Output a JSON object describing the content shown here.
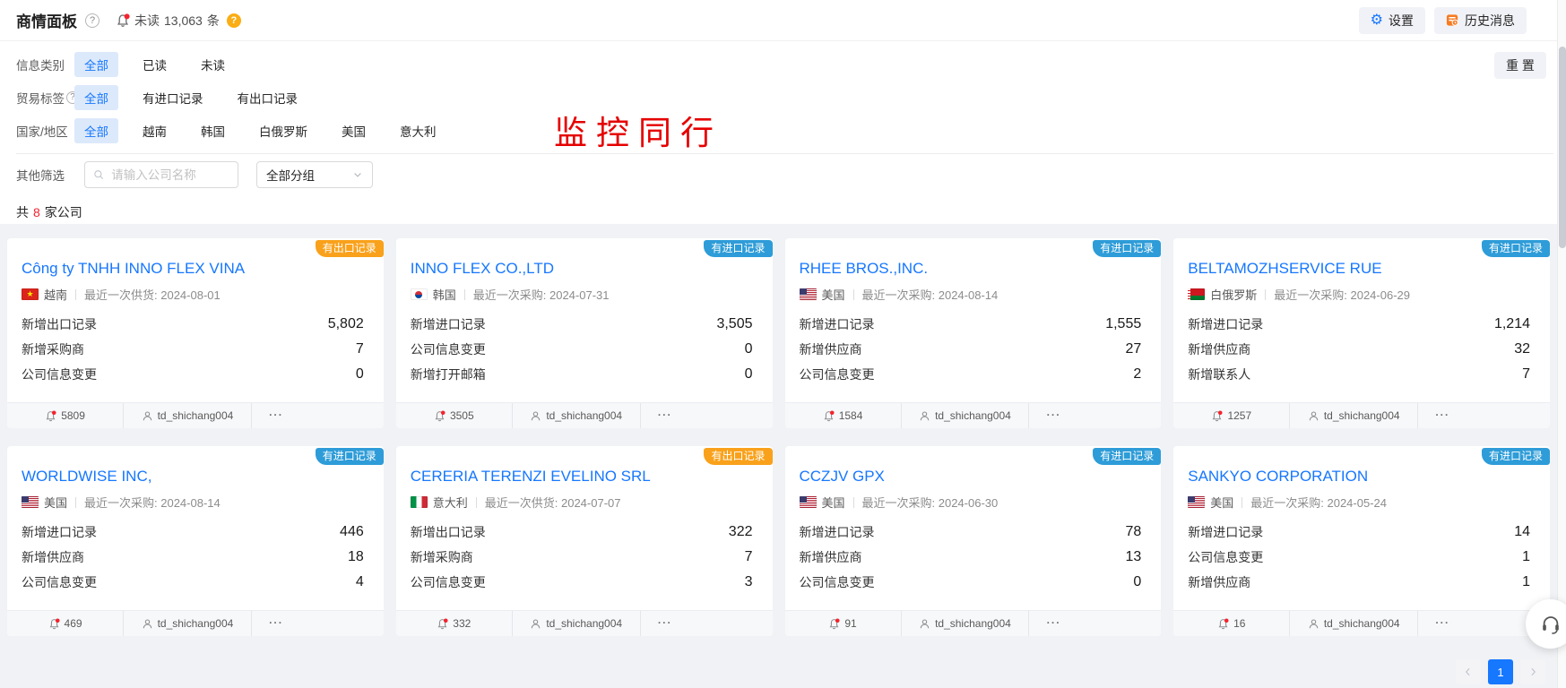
{
  "header": {
    "title": "商情面板",
    "unread_label": "未读",
    "unread_count": "13,063",
    "unread_unit": "条",
    "settings_button": "设置",
    "history_button": "历史消息"
  },
  "filters": {
    "reset_button": "重 置",
    "rows": [
      {
        "label": "信息类别",
        "has_help": false,
        "selected": 0,
        "options": [
          "全部",
          "已读",
          "未读"
        ]
      },
      {
        "label": "贸易标签",
        "has_help": true,
        "selected": 0,
        "options": [
          "全部",
          "有进口记录",
          "有出口记录"
        ]
      },
      {
        "label": "国家/地区",
        "has_help": false,
        "selected": 0,
        "options": [
          "全部",
          "越南",
          "韩国",
          "白俄罗斯",
          "美国",
          "意大利"
        ]
      }
    ],
    "other_label": "其他筛选",
    "search_placeholder": "请输入公司名称",
    "group_select_value": "全部分组"
  },
  "annotation": "监控同行",
  "summary": {
    "prefix": "共",
    "count": "8",
    "suffix": "家公司"
  },
  "labels": {
    "more": "..."
  },
  "cards": [
    {
      "badge": "有出口记录",
      "badge_type": "export",
      "name": "Công ty TNHH INNO FLEX VINA",
      "flag": "vn",
      "country": "越南",
      "last_trade": "最近一次供货: 2024-08-01",
      "metrics": [
        {
          "label": "新增出口记录",
          "value": "5,802"
        },
        {
          "label": "新增采购商",
          "value": "7"
        },
        {
          "label": "公司信息变更",
          "value": "0"
        }
      ],
      "bell_count": "5809",
      "owner": "td_shichang004"
    },
    {
      "badge": "有进口记录",
      "badge_type": "import",
      "name": "INNO FLEX CO.,LTD",
      "flag": "kr",
      "country": "韩国",
      "last_trade": "最近一次采购: 2024-07-31",
      "metrics": [
        {
          "label": "新增进口记录",
          "value": "3,505"
        },
        {
          "label": "公司信息变更",
          "value": "0"
        },
        {
          "label": "新增打开邮箱",
          "value": "0"
        }
      ],
      "bell_count": "3505",
      "owner": "td_shichang004"
    },
    {
      "badge": "有进口记录",
      "badge_type": "import",
      "name": "RHEE BROS.,INC.",
      "flag": "us",
      "country": "美国",
      "last_trade": "最近一次采购: 2024-08-14",
      "metrics": [
        {
          "label": "新增进口记录",
          "value": "1,555"
        },
        {
          "label": "新增供应商",
          "value": "27"
        },
        {
          "label": "公司信息变更",
          "value": "2"
        }
      ],
      "bell_count": "1584",
      "owner": "td_shichang004"
    },
    {
      "badge": "有进口记录",
      "badge_type": "import",
      "name": "BELTAMOZHSERVICE RUE",
      "flag": "by",
      "country": "白俄罗斯",
      "last_trade": "最近一次采购: 2024-06-29",
      "metrics": [
        {
          "label": "新增进口记录",
          "value": "1,214"
        },
        {
          "label": "新增供应商",
          "value": "32"
        },
        {
          "label": "新增联系人",
          "value": "7"
        }
      ],
      "bell_count": "1257",
      "owner": "td_shichang004"
    },
    {
      "badge": "有进口记录",
      "badge_type": "import",
      "name": "WORLDWISE INC,",
      "flag": "us",
      "country": "美国",
      "last_trade": "最近一次采购: 2024-08-14",
      "metrics": [
        {
          "label": "新增进口记录",
          "value": "446"
        },
        {
          "label": "新增供应商",
          "value": "18"
        },
        {
          "label": "公司信息变更",
          "value": "4"
        }
      ],
      "bell_count": "469",
      "owner": "td_shichang004"
    },
    {
      "badge": "有出口记录",
      "badge_type": "export",
      "name": "CERERIA TERENZI EVELINO SRL",
      "flag": "it",
      "country": "意大利",
      "last_trade": "最近一次供货: 2024-07-07",
      "metrics": [
        {
          "label": "新增出口记录",
          "value": "322"
        },
        {
          "label": "新增采购商",
          "value": "7"
        },
        {
          "label": "公司信息变更",
          "value": "3"
        }
      ],
      "bell_count": "332",
      "owner": "td_shichang004"
    },
    {
      "badge": "有进口记录",
      "badge_type": "import",
      "name": "CCZJV GPX",
      "flag": "us",
      "country": "美国",
      "last_trade": "最近一次采购: 2024-06-30",
      "metrics": [
        {
          "label": "新增进口记录",
          "value": "78"
        },
        {
          "label": "新增供应商",
          "value": "13"
        },
        {
          "label": "公司信息变更",
          "value": "0"
        }
      ],
      "bell_count": "91",
      "owner": "td_shichang004"
    },
    {
      "badge": "有进口记录",
      "badge_type": "import",
      "name": "SANKYO CORPORATION",
      "flag": "us",
      "country": "美国",
      "last_trade": "最近一次采购: 2024-05-24",
      "metrics": [
        {
          "label": "新增进口记录",
          "value": "14"
        },
        {
          "label": "公司信息变更",
          "value": "1"
        },
        {
          "label": "新增供应商",
          "value": "1"
        }
      ],
      "bell_count": "16",
      "owner": "td_shichang004"
    }
  ],
  "pagination": {
    "current": "1"
  },
  "colors": {
    "accent_blue": "#1677ff",
    "badge_import_blue": "#2e9cd8",
    "badge_export_orange": "#f9a11b",
    "alert_red": "#f5222d",
    "help_orange": "#faad14",
    "annotation_red": "#e60000"
  }
}
